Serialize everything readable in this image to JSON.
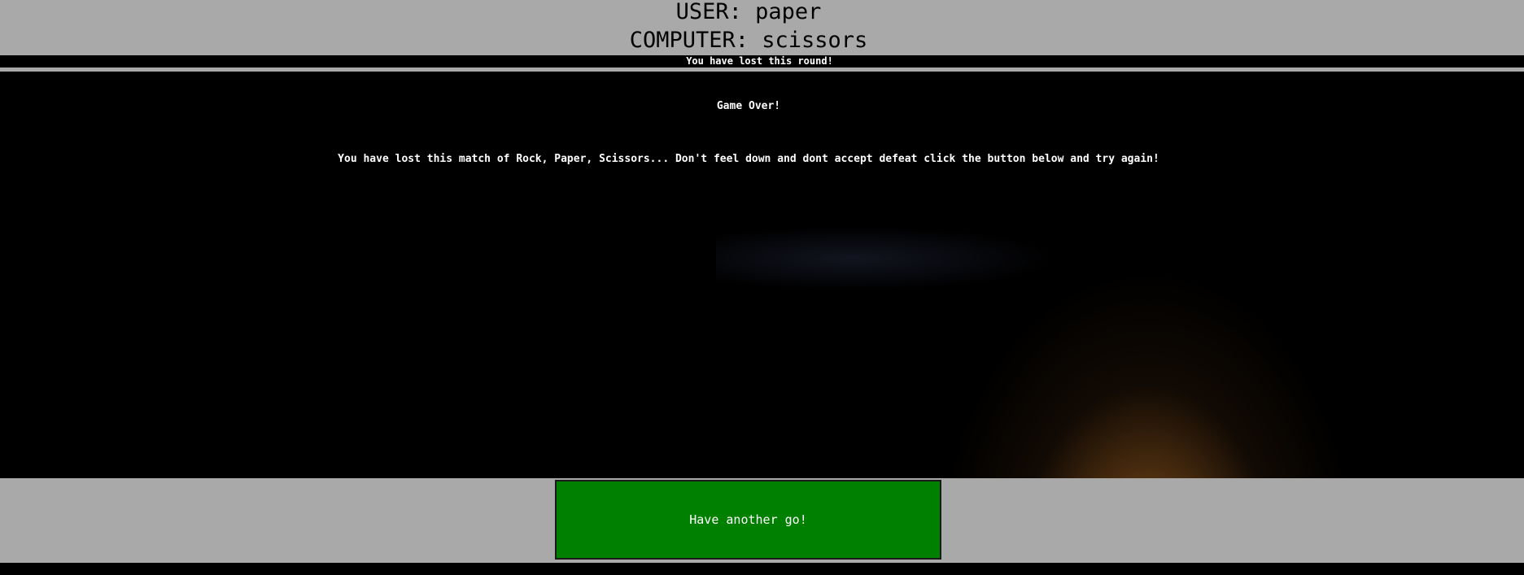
{
  "header": {
    "user_line": "USER: paper",
    "computer_line": "COMPUTER: scissors"
  },
  "round": {
    "result_text": "You have lost this round!"
  },
  "stage": {
    "game_over_text": "Game Over!",
    "match_message": "You have lost this match of Rock, Paper, Scissors... Don't feel down and dont accept defeat click the button below and try again!"
  },
  "footer": {
    "retry_label": "Have another go!"
  },
  "colors": {
    "panel_gray": "#a9a9a9",
    "background": "#000000",
    "button_green": "#008000",
    "text_light": "#ffffff"
  }
}
